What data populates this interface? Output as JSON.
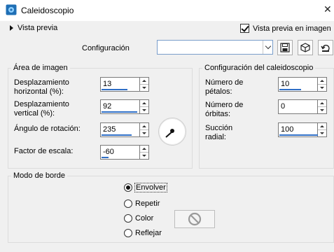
{
  "window": {
    "title": "Caleidoscopio",
    "icon": "app-logo-icon",
    "close_icon": "close-icon"
  },
  "preview": {
    "toggle_label": "Vista previa",
    "checkbox_label": "Vista previa en imagen",
    "checked": true
  },
  "config": {
    "label": "Configuración",
    "select_value": "",
    "buttons": [
      "save-preset-icon",
      "load-preset-icon",
      "reset-icon"
    ]
  },
  "area_group": {
    "title": "Área de imagen",
    "horizontal_offset": {
      "label_line1": "Desplazamiento",
      "label_line2": "horizontal (%):",
      "value": "13"
    },
    "vertical_offset": {
      "label_line1": "Desplazamiento",
      "label_line2": "vertical (%):",
      "value": "92"
    },
    "rotation_angle": {
      "label": "Ángulo de rotación:",
      "value": "235"
    },
    "scale_factor": {
      "label": "Factor de escala:",
      "value": "-60"
    }
  },
  "kaleido_group": {
    "title": "Configuración del caleidoscopio",
    "petals": {
      "label_line1": "Número de",
      "label_line2": "pétalos:",
      "value": "10"
    },
    "orbits": {
      "label_line1": "Número de",
      "label_line2": "órbitas:",
      "value": "0"
    },
    "radial_suction": {
      "label_line1": "Succión",
      "label_line2": "radial:",
      "value": "100"
    }
  },
  "edge_group": {
    "title": "Modo de borde",
    "options": [
      {
        "label": "Envolver",
        "selected": true
      },
      {
        "label": "Repetir",
        "selected": false
      },
      {
        "label": "Color",
        "selected": false
      },
      {
        "label": "Reflejar",
        "selected": false
      }
    ],
    "color_swatch_icon": "no-color-icon"
  },
  "colors": {
    "accent": "#2f6fc6",
    "app_icon": "#1f6fb5"
  }
}
